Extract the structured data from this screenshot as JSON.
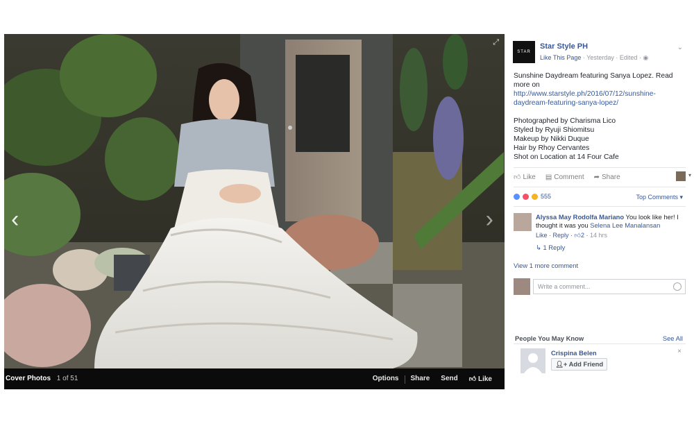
{
  "viewer": {
    "album_title": "Cover Photos",
    "position": "1 of 51",
    "actions": [
      "Options",
      "Share",
      "Send",
      "Like"
    ]
  },
  "post": {
    "page_name": "Star Style PH",
    "logo_text": "STAR",
    "like_page": "Like This Page",
    "time": "Yesterday",
    "edited": "Edited",
    "caption_line1": "Sunshine Daydream featuring Sanya Lopez.  Read more on ",
    "caption_link": "http://www.starstyle.ph/2016/07/12/sunshine-daydream-featuring-sanya-lopez/",
    "credits": [
      "Photographed by Charisma Lico",
      "Styled by Ryuji Shiomitsu",
      "Makeup by Nikki Duque",
      "Hair by Rhoy Cervantes",
      "Shot on Location at 14 Four Cafe"
    ],
    "actions": {
      "like": "Like",
      "comment": "Comment",
      "share": "Share"
    },
    "reaction_count": "555",
    "top_comments": "Top Comments ▾"
  },
  "comment": {
    "author": "Alyssa May Rodolfa Mariano",
    "text": " You look like her! I thought it was you ",
    "mention": "Selena Lee Manalansan",
    "like": "Like",
    "reply": "Reply",
    "likes": "2",
    "time": "14 hrs",
    "reply_link": "1 Reply"
  },
  "view_more": "View 1 more comment",
  "write_placeholder": "Write a comment...",
  "pymk": {
    "title": "People You May Know",
    "see_all": "See All",
    "person_name": "Crispina Belen",
    "add_friend": "Add Friend"
  },
  "colors": {
    "link": "#365899",
    "bar": "#0b0b0b"
  }
}
